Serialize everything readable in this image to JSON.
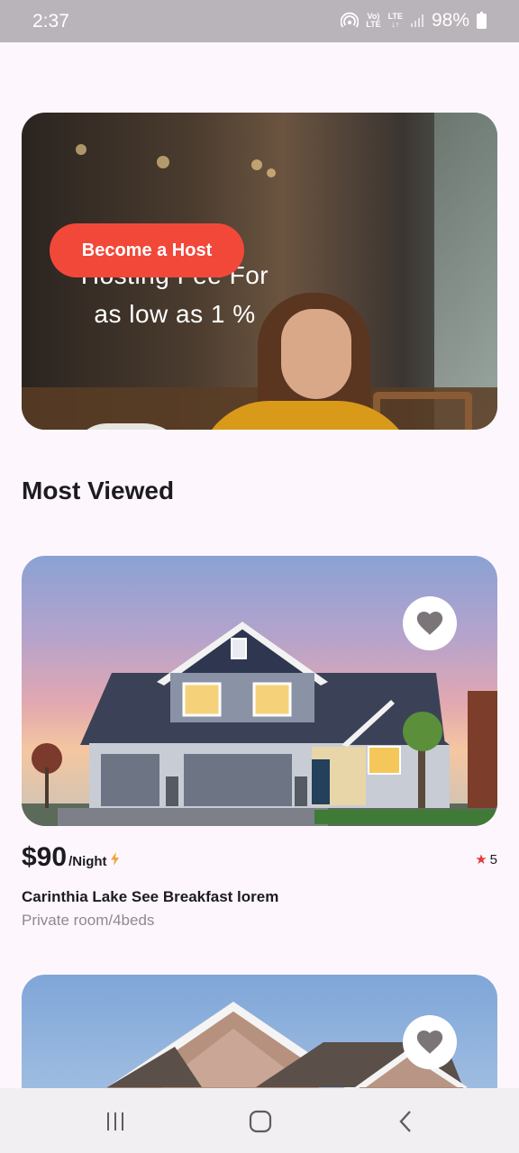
{
  "status_bar": {
    "time": "2:37",
    "network_top": "Vo)",
    "network_bottom": "LTE",
    "lte_top": "LTE",
    "lte_bottom": "↓↑",
    "battery": "98%",
    "icons": [
      "hotspot-icon",
      "volte-icon",
      "lte-icon",
      "signal-icon",
      "battery-icon"
    ]
  },
  "banner": {
    "title_line1": "Hosting Fee For",
    "title_line2": "as low as 1 %",
    "button_label": "Become a Host"
  },
  "section": {
    "title": "Most Viewed"
  },
  "listings": [
    {
      "price": "$90",
      "per": "/Night",
      "rating": "5",
      "title": "Carinthia Lake See Breakfast lorem",
      "subtitle": "Private room/4beds",
      "favorite_icon": "heart-icon"
    },
    {
      "favorite_icon": "heart-icon"
    }
  ],
  "colors": {
    "accent": "#f2483a",
    "star": "#e53935",
    "bolt": "#f4a13a",
    "background": "#fdf7fd"
  },
  "nav_bar": {
    "icons": [
      "recent-apps-icon",
      "home-icon",
      "back-icon"
    ]
  }
}
